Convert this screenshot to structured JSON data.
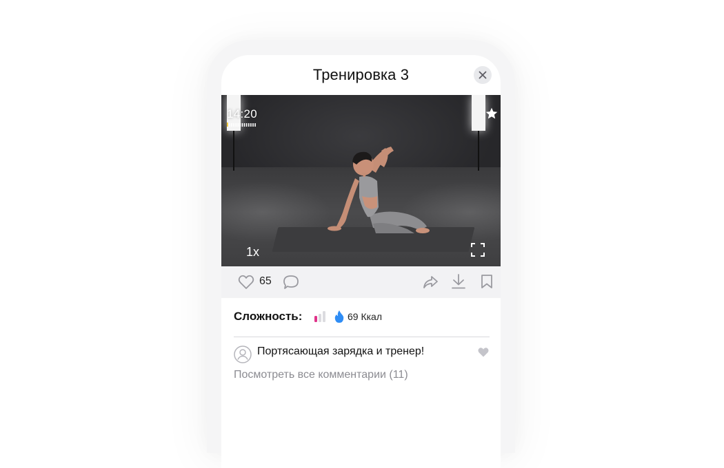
{
  "header": {
    "title": "Тренировка 3"
  },
  "video": {
    "timer": "14:20",
    "speed": "1x",
    "progress": 0.08
  },
  "actions": {
    "likes": "65"
  },
  "info": {
    "difficulty_label": "Сложность:",
    "difficulty_level": 1,
    "difficulty_max": 3,
    "calories": "69 Ккал"
  },
  "comments": {
    "top_comment": "Портясающая зарядка и тренер!",
    "view_all": "Посмотреть все комментарии (11)"
  },
  "colors": {
    "accent_pink": "#e0338a",
    "fire_blue": "#2f8df5",
    "muted_icon": "#c4c4ca"
  }
}
